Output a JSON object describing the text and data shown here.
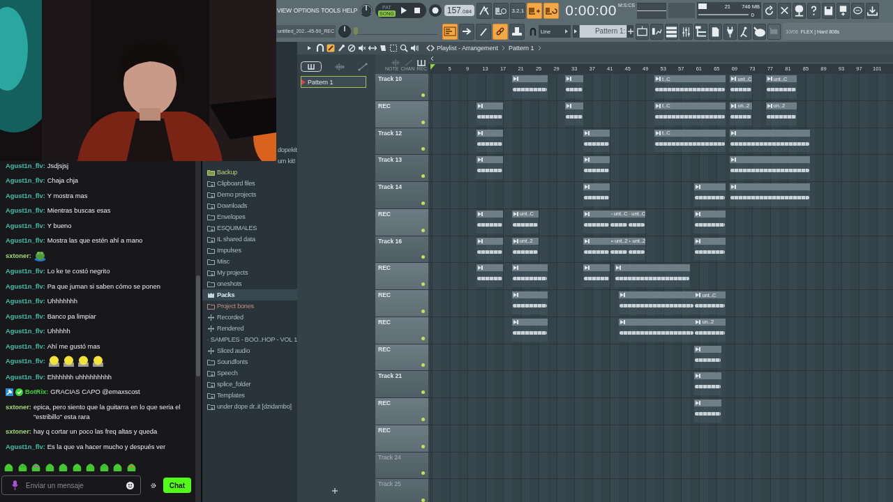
{
  "chat": {
    "messages": [
      {
        "user": "Agust1n_flv:",
        "color": "#3fbfa8",
        "text": "Jsdjsjsj"
      },
      {
        "user": "Agust1n_flv:",
        "color": "#3fbfa8",
        "text": "Chaja chja"
      },
      {
        "user": "Agust1n_flv:",
        "color": "#3fbfa8",
        "text": "Y mostra mas"
      },
      {
        "user": "Agust1n_flv:",
        "color": "#3fbfa8",
        "text": "Mientras buscas esas"
      },
      {
        "user": "Agust1n_flv:",
        "color": "#3fbfa8",
        "text": "Y bueno"
      },
      {
        "user": "Agust1n_flv:",
        "color": "#3fbfa8",
        "text": "Mostra las que estén ahí a mano"
      },
      {
        "user": "sxtoner:",
        "color": "#a3d977",
        "emotes": [
          {
            "kind": "frog"
          }
        ]
      },
      {
        "user": "Agust1n_flv:",
        "color": "#3fbfa8",
        "text": "Lo ke te costó negrito"
      },
      {
        "user": "Agust1n_flv:",
        "color": "#3fbfa8",
        "text": "Pa que juman si saben cómo se ponen"
      },
      {
        "user": "Agust1n_flv:",
        "color": "#3fbfa8",
        "text": "Uhhhhhhh"
      },
      {
        "user": "Agust1n_flv:",
        "color": "#3fbfa8",
        "text": "Banco pa limpiar"
      },
      {
        "user": "Agust1n_flv:",
        "color": "#3fbfa8",
        "text": "Uhhhhh"
      },
      {
        "user": "Agust1n_flv:",
        "color": "#3fbfa8",
        "text": "Ahí me gustó mas"
      },
      {
        "user": "Agust1n_flv:",
        "color": "#3fbfa8",
        "emotes": [
          {
            "kind": "smiley"
          },
          {
            "kind": "smiley"
          },
          {
            "kind": "smiley"
          },
          {
            "kind": "smiley"
          }
        ]
      },
      {
        "user": "Agust1n_flv:",
        "color": "#3fbfa8",
        "text": "Ehhhhhh uhhhhhhhhh"
      },
      {
        "user": "BotRix:",
        "color": "#3bd43b",
        "text": "GRACIAS CAPO @emaxscost",
        "badges": [
          {
            "kind": "moderator"
          },
          {
            "kind": "verified"
          }
        ]
      },
      {
        "user": "sxtoner:",
        "color": "#a3d977",
        "text": "epica, pero siento que la guitarra en lo que seria el \"estribillo\" esta rara"
      },
      {
        "user": "sxtoner:",
        "color": "#a3d977",
        "text": "hay q cortar un poco las freq altas y queda"
      },
      {
        "user": "Agust1n_flv:",
        "color": "#3fbfa8",
        "text": "Es la que va hacer mucho y después ver"
      }
    ],
    "input": {
      "placeholder": "Enviar un mensaje"
    },
    "send_button": "Chat"
  },
  "toolbar": {
    "menu": [
      "VIEW",
      "OPTIONS",
      "TOOLS",
      "HELP"
    ],
    "project_file": "untitled_202..-45-50_REC",
    "mode": [
      {
        "label": "PAT",
        "selected": false
      },
      {
        "label": "SONG",
        "selected": true
      }
    ],
    "tempo": "157",
    "tempo_fraction": ".084",
    "toggles_top": [
      {
        "on": false
      },
      {
        "on": false
      },
      {
        "label": "3.2.1",
        "on": false
      },
      {
        "on": true
      },
      {
        "on": true
      }
    ],
    "toggles_bottom": [
      {
        "on": true
      },
      {
        "on": false
      },
      {
        "on": false
      },
      {
        "on": true
      },
      {
        "on": false
      }
    ],
    "time": "0:00:00",
    "time_format": "M:S:CS",
    "cpu": "21",
    "memory": "746 MB",
    "polyphony": "0",
    "pitch_slider": {
      "level": 0.0
    },
    "snap": "Line",
    "pattern": "Pattern 1:",
    "hint_counter": "10/08",
    "hint": "FLEX | Hard 808s"
  },
  "browser": {
    "items": [
      {
        "label": "dopekit",
        "kind": "partial",
        "selected": false
      },
      {
        "label": "um kit!",
        "kind": "partial",
        "selected": false
      },
      {
        "label": "Backup",
        "kind": "backup",
        "selected": false
      },
      {
        "label": "Clipboard files",
        "kind": "linked",
        "selected": false
      },
      {
        "label": "Demo projects",
        "kind": "linked",
        "selected": false
      },
      {
        "label": "Downloads",
        "kind": "linked",
        "selected": false
      },
      {
        "label": "Envelopes",
        "kind": "folder",
        "selected": false
      },
      {
        "label": "ESQUIMALES",
        "kind": "linked",
        "selected": false
      },
      {
        "label": "IL shared data",
        "kind": "linked",
        "selected": false
      },
      {
        "label": "Impulses",
        "kind": "folder",
        "selected": false
      },
      {
        "label": "Misc",
        "kind": "folder",
        "selected": false
      },
      {
        "label": "My projects",
        "kind": "linked",
        "selected": false
      },
      {
        "label": "oneshots",
        "kind": "folder",
        "selected": false
      },
      {
        "label": "Packs",
        "kind": "packs",
        "selected": true
      },
      {
        "label": "Project bones",
        "kind": "project",
        "selected": false
      },
      {
        "label": "Recorded",
        "kind": "special",
        "selected": false
      },
      {
        "label": "Rendered",
        "kind": "special",
        "selected": false
      },
      {
        "label": "SAMPLES - BOO..HOP -  VOL 1",
        "kind": "linked",
        "selected": false
      },
      {
        "label": "Sliced audio",
        "kind": "special",
        "selected": false
      },
      {
        "label": "Soundfonts",
        "kind": "folder",
        "selected": false
      },
      {
        "label": "Speech",
        "kind": "linked",
        "selected": false
      },
      {
        "label": "splice_folder",
        "kind": "linked",
        "selected": false
      },
      {
        "label": "Templates",
        "kind": "linked",
        "selected": false
      },
      {
        "label": "under dope dr..it [dzidambo]",
        "kind": "linked",
        "selected": false
      }
    ]
  },
  "playlist": {
    "breadcrumb": [
      "Playlist - Arrangement",
      "Pattern 1"
    ],
    "patterns": [
      {
        "label": "Pattern 1",
        "selected": true
      }
    ],
    "header_labels": [
      "NOTE",
      "CHAN",
      "REC"
    ],
    "ruler": [
      "5",
      "9",
      "13",
      "17",
      "21",
      "25",
      "29",
      "33",
      "37",
      "41",
      "45",
      "49",
      "53",
      "57",
      "61",
      "65",
      "69",
      "73",
      "77",
      "81",
      "85",
      "89",
      "93",
      "97",
      "101"
    ],
    "tracks": [
      {
        "name": "Track 10",
        "selected": false,
        "dimmed": false,
        "clip_labels": [
          "t..C",
          "unt..C",
          "unt..C"
        ]
      },
      {
        "name": "REC",
        "selected": true,
        "dimmed": false,
        "clip_labels": [
          "t..C",
          "un..2",
          "un..2"
        ]
      },
      {
        "name": "Track 12",
        "selected": false,
        "dimmed": false,
        "clip_labels": [
          "t..C"
        ]
      },
      {
        "name": "Track 13",
        "selected": false,
        "dimmed": false
      },
      {
        "name": "Track 14",
        "selected": false,
        "dimmed": false
      },
      {
        "name": "REC",
        "selected": true,
        "dimmed": false,
        "clip_labels": [
          "unt..C",
          "unt..C",
          "unt..C"
        ]
      },
      {
        "name": "Track 16",
        "selected": false,
        "dimmed": false,
        "clip_labels": [
          "unt..2",
          "unt..2",
          "unt..2"
        ]
      },
      {
        "name": "REC",
        "selected": true,
        "dimmed": false
      },
      {
        "name": "REC",
        "selected": true,
        "dimmed": false,
        "clip_labels": [
          "unt..C"
        ]
      },
      {
        "name": "REC",
        "selected": true,
        "dimmed": false,
        "clip_labels": [
          "un..2"
        ]
      },
      {
        "name": "REC",
        "selected": true,
        "dimmed": false
      },
      {
        "name": "Track 21",
        "selected": false,
        "dimmed": false
      },
      {
        "name": "REC",
        "selected": true,
        "dimmed": false
      },
      {
        "name": "REC",
        "selected": true,
        "dimmed": false
      },
      {
        "name": "Track 24",
        "selected": false,
        "dimmed": true
      },
      {
        "name": "Track 25",
        "selected": false,
        "dimmed": true
      }
    ]
  }
}
